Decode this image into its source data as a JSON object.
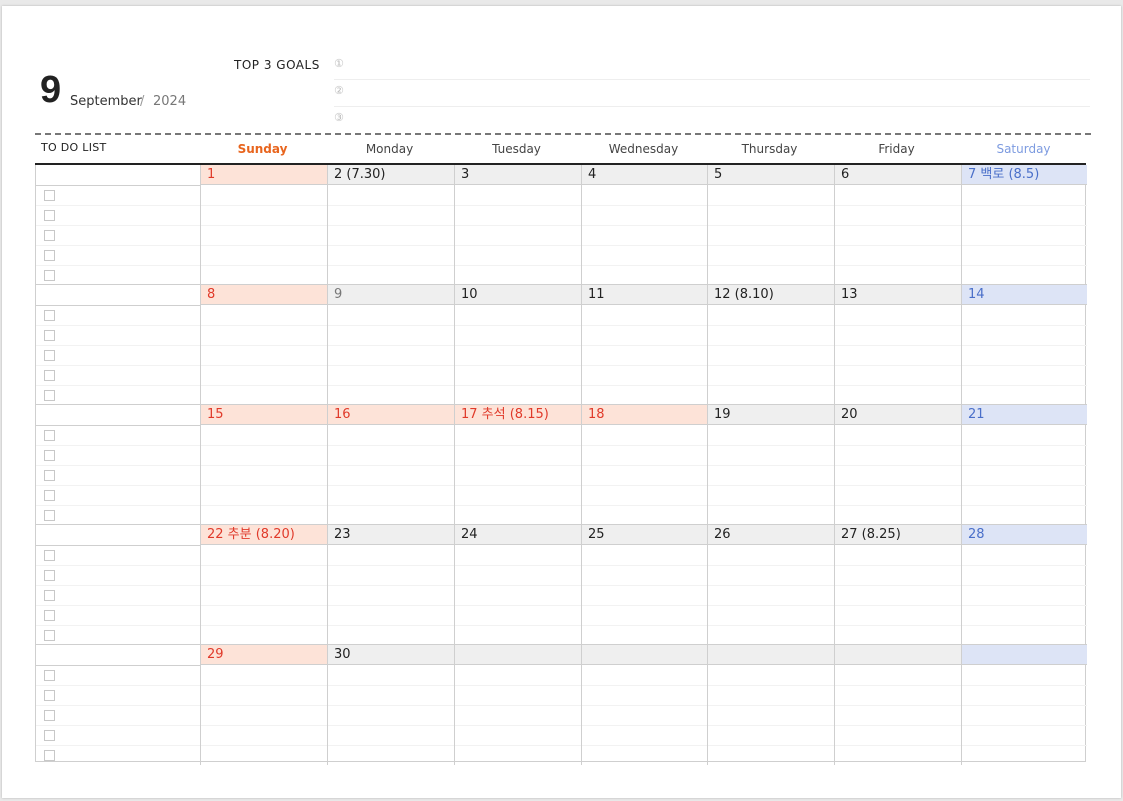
{
  "header": {
    "month_number": "9",
    "month_name": "September",
    "separator": "/",
    "year": "2024"
  },
  "goals": {
    "title": "TOP 3 GOALS",
    "markers": [
      "①",
      "②",
      "③"
    ]
  },
  "todo": {
    "title": "TO DO LIST"
  },
  "weekdays": [
    {
      "label": "Sunday",
      "color": "#e8651e",
      "bold": true
    },
    {
      "label": "Monday",
      "color": "#444444",
      "bold": false
    },
    {
      "label": "Tuesday",
      "color": "#444444",
      "bold": false
    },
    {
      "label": "Wednesday",
      "color": "#444444",
      "bold": false
    },
    {
      "label": "Thursday",
      "color": "#444444",
      "bold": false
    },
    {
      "label": "Friday",
      "color": "#444444",
      "bold": false
    },
    {
      "label": "Saturday",
      "color": "#7d9be0",
      "bold": false
    }
  ],
  "weeks": [
    {
      "days": [
        {
          "text": "1",
          "bg": "sun",
          "color": "red"
        },
        {
          "text": "2  (7.30)",
          "bg": "week",
          "color": "dark"
        },
        {
          "text": "3",
          "bg": "week",
          "color": "dark"
        },
        {
          "text": "4",
          "bg": "week",
          "color": "dark"
        },
        {
          "text": "5",
          "bg": "week",
          "color": "dark"
        },
        {
          "text": "6",
          "bg": "week",
          "color": "dark"
        },
        {
          "text": "7  백로  (8.5)",
          "bg": "sat",
          "color": "blue"
        }
      ]
    },
    {
      "days": [
        {
          "text": "8",
          "bg": "sun",
          "color": "red"
        },
        {
          "text": "9",
          "bg": "week",
          "color": "gray"
        },
        {
          "text": "10",
          "bg": "week",
          "color": "dark"
        },
        {
          "text": "11",
          "bg": "week",
          "color": "dark"
        },
        {
          "text": "12  (8.10)",
          "bg": "week",
          "color": "dark"
        },
        {
          "text": "13",
          "bg": "week",
          "color": "dark"
        },
        {
          "text": "14",
          "bg": "sat",
          "color": "blue"
        }
      ]
    },
    {
      "days": [
        {
          "text": "15",
          "bg": "sun",
          "color": "red"
        },
        {
          "text": "16",
          "bg": "sun",
          "color": "red"
        },
        {
          "text": "17  추석  (8.15)",
          "bg": "sun",
          "color": "red"
        },
        {
          "text": "18",
          "bg": "sun",
          "color": "red"
        },
        {
          "text": "19",
          "bg": "week",
          "color": "dark"
        },
        {
          "text": "20",
          "bg": "week",
          "color": "dark"
        },
        {
          "text": "21",
          "bg": "sat",
          "color": "blue"
        }
      ]
    },
    {
      "days": [
        {
          "text": "22  추분  (8.20)",
          "bg": "sun",
          "color": "red"
        },
        {
          "text": "23",
          "bg": "week",
          "color": "dark"
        },
        {
          "text": "24",
          "bg": "week",
          "color": "dark"
        },
        {
          "text": "25",
          "bg": "week",
          "color": "dark"
        },
        {
          "text": "26",
          "bg": "week",
          "color": "dark"
        },
        {
          "text": "27  (8.25)",
          "bg": "week",
          "color": "dark"
        },
        {
          "text": "28",
          "bg": "sat",
          "color": "blue"
        }
      ]
    },
    {
      "days": [
        {
          "text": "29",
          "bg": "sun",
          "color": "red"
        },
        {
          "text": "30",
          "bg": "week",
          "color": "dark"
        },
        {
          "text": "",
          "bg": "week",
          "color": "dark"
        },
        {
          "text": "",
          "bg": "week",
          "color": "dark"
        },
        {
          "text": "",
          "bg": "week",
          "color": "dark"
        },
        {
          "text": "",
          "bg": "week",
          "color": "dark"
        },
        {
          "text": "",
          "bg": "sat",
          "color": "blue"
        }
      ]
    }
  ],
  "icons": {
    "checkbox": "checkbox-icon"
  }
}
